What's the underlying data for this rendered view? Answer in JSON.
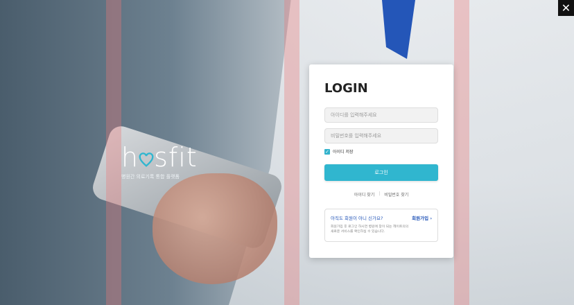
{
  "close": {
    "icon": "close-icon",
    "label": "✕"
  },
  "brand": {
    "logo_text": "hosfit",
    "tagline": "병원간 의료기록 통합 플랫폼"
  },
  "login": {
    "title": "LOGIN",
    "id_placeholder": "아이디를 입력해주세요",
    "pw_placeholder": "비밀번호를 입력해주세요",
    "remember_label": "아이디 저장",
    "remember_checked": true,
    "submit_label": "로그인",
    "find_id_label": "아이디 찾기",
    "separator": "|",
    "find_pw_label": "비밀번호 찾기"
  },
  "signup": {
    "question": "아직도 회원이 아니 신가요?",
    "link_label": "회원가입",
    "desc_line1": "회원가입 후 로그인 하시면 병원에 창이 되는 헤이트의의",
    "desc_line2": "새로운 서비스를 확인하실 수 있습니다."
  },
  "colors": {
    "accent": "#30b6cf",
    "link": "#2456b8"
  }
}
